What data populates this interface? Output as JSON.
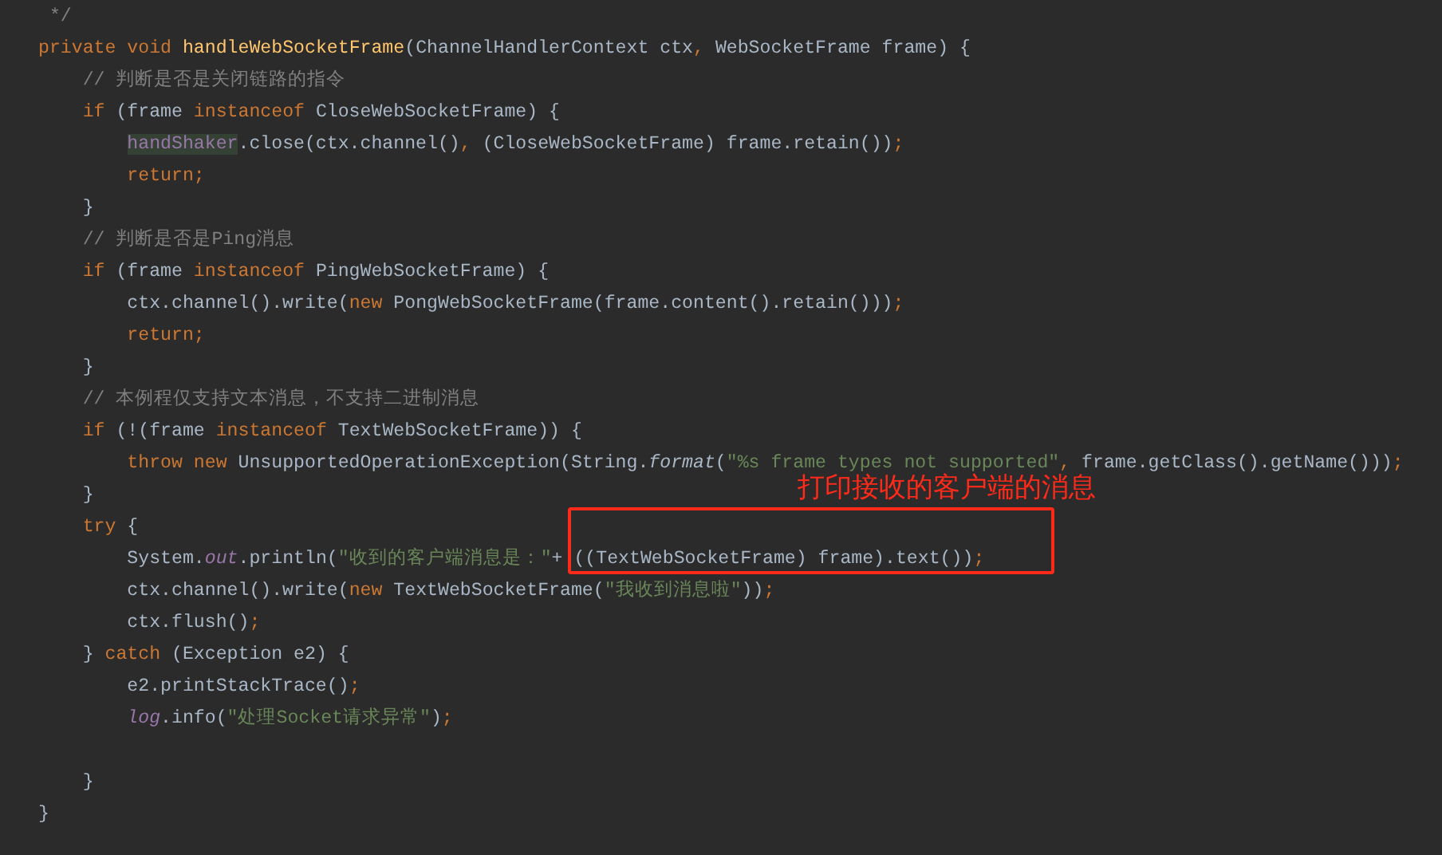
{
  "code_lines": [
    {
      "kind": "code",
      "tokens": [
        {
          "t": " */",
          "kind": "comment"
        }
      ]
    },
    {
      "kind": "code",
      "tokens": [
        {
          "t": "private void ",
          "kind": "keyword"
        },
        {
          "t": "handleWebSocketFrame",
          "kind": "decl"
        },
        {
          "t": "(ChannelHandlerContext ctx",
          "kind": "plain"
        },
        {
          "t": ", ",
          "kind": "keyword"
        },
        {
          "t": "WebSocketFrame frame) {",
          "kind": "plain"
        }
      ]
    },
    {
      "kind": "code",
      "tokens": [
        {
          "t": "    // 判断是否是关闭链路的指令",
          "kind": "comment"
        }
      ]
    },
    {
      "kind": "code",
      "tokens": [
        {
          "t": "    if ",
          "kind": "keyword"
        },
        {
          "t": "(frame ",
          "kind": "plain"
        },
        {
          "t": "instanceof ",
          "kind": "keyword"
        },
        {
          "t": "CloseWebSocketFrame) {",
          "kind": "plain"
        }
      ]
    },
    {
      "kind": "code",
      "indented": true,
      "tokens": [
        {
          "t": "handShaker",
          "kind": "highlight"
        },
        {
          "t": ".close(ctx.channel()",
          "kind": "plain"
        },
        {
          "t": ", ",
          "kind": "keyword"
        },
        {
          "t": "(CloseWebSocketFrame) frame.retain())",
          "kind": "plain"
        },
        {
          "t": ";",
          "kind": "keyword"
        }
      ]
    },
    {
      "kind": "code",
      "tokens": [
        {
          "t": "        return;",
          "kind": "keyword"
        }
      ]
    },
    {
      "kind": "code",
      "tokens": [
        {
          "t": "    }",
          "kind": "plain"
        }
      ]
    },
    {
      "kind": "code",
      "tokens": [
        {
          "t": "    // 判断是否是Ping消息",
          "kind": "comment"
        }
      ]
    },
    {
      "kind": "code",
      "tokens": [
        {
          "t": "    if ",
          "kind": "keyword"
        },
        {
          "t": "(frame ",
          "kind": "plain"
        },
        {
          "t": "instanceof ",
          "kind": "keyword"
        },
        {
          "t": "PingWebSocketFrame) {",
          "kind": "plain"
        }
      ]
    },
    {
      "kind": "code",
      "tokens": [
        {
          "t": "        ctx.channel().write(",
          "kind": "plain"
        },
        {
          "t": "new ",
          "kind": "keyword"
        },
        {
          "t": "PongWebSocketFrame(frame.content().retain()))",
          "kind": "plain"
        },
        {
          "t": ";",
          "kind": "keyword"
        }
      ]
    },
    {
      "kind": "code",
      "tokens": [
        {
          "t": "        return;",
          "kind": "keyword"
        }
      ]
    },
    {
      "kind": "code",
      "tokens": [
        {
          "t": "    }",
          "kind": "plain"
        }
      ]
    },
    {
      "kind": "code",
      "tokens": [
        {
          "t": "    // 本例程仅支持文本消息，不支持二进制消息",
          "kind": "comment"
        }
      ]
    },
    {
      "kind": "code",
      "tokens": [
        {
          "t": "    if ",
          "kind": "keyword"
        },
        {
          "t": "(!(frame ",
          "kind": "plain"
        },
        {
          "t": "instanceof ",
          "kind": "keyword"
        },
        {
          "t": "TextWebSocketFrame)) {",
          "kind": "plain"
        }
      ]
    },
    {
      "kind": "code",
      "tokens": [
        {
          "t": "        throw new ",
          "kind": "keyword"
        },
        {
          "t": "UnsupportedOperationException(String.",
          "kind": "plain"
        },
        {
          "t": "format",
          "kind": "static_method"
        },
        {
          "t": "(",
          "kind": "plain"
        },
        {
          "t": "\"%s frame types not supported\"",
          "kind": "string"
        },
        {
          "t": ", ",
          "kind": "keyword"
        },
        {
          "t": "frame.getClass().getName()))",
          "kind": "plain"
        },
        {
          "t": ";",
          "kind": "keyword"
        }
      ]
    },
    {
      "kind": "code",
      "tokens": [
        {
          "t": "    }",
          "kind": "plain"
        }
      ]
    },
    {
      "kind": "code",
      "tokens": [
        {
          "t": "    try ",
          "kind": "keyword"
        },
        {
          "t": "{",
          "kind": "plain"
        }
      ]
    },
    {
      "kind": "code",
      "tokens": [
        {
          "t": "        System.",
          "kind": "plain"
        },
        {
          "t": "out",
          "kind": "static_field"
        },
        {
          "t": ".println(",
          "kind": "plain"
        },
        {
          "t": "\"收到的客户端消息是：\"",
          "kind": "string"
        },
        {
          "t": "+ ((TextWebSocketFrame) frame).text())",
          "kind": "plain"
        },
        {
          "t": ";",
          "kind": "keyword"
        }
      ]
    },
    {
      "kind": "code",
      "tokens": [
        {
          "t": "        ctx.channel().write(",
          "kind": "plain"
        },
        {
          "t": "new ",
          "kind": "keyword"
        },
        {
          "t": "TextWebSocketFrame(",
          "kind": "plain"
        },
        {
          "t": "\"我收到消息啦\"",
          "kind": "string"
        },
        {
          "t": "))",
          "kind": "plain"
        },
        {
          "t": ";",
          "kind": "keyword"
        }
      ]
    },
    {
      "kind": "code",
      "tokens": [
        {
          "t": "        ctx.flush()",
          "kind": "plain"
        },
        {
          "t": ";",
          "kind": "keyword"
        }
      ]
    },
    {
      "kind": "code",
      "tokens": [
        {
          "t": "    } ",
          "kind": "plain"
        },
        {
          "t": "catch ",
          "kind": "keyword"
        },
        {
          "t": "(Exception e2) {",
          "kind": "plain"
        }
      ]
    },
    {
      "kind": "code",
      "tokens": [
        {
          "t": "        e2.printStackTrace()",
          "kind": "plain"
        },
        {
          "t": ";",
          "kind": "keyword"
        }
      ]
    },
    {
      "kind": "code",
      "indented": true,
      "tokens": [
        {
          "t": "log",
          "kind": "static_field"
        },
        {
          "t": ".info(",
          "kind": "plain"
        },
        {
          "t": "\"处理Socket请求异常\"",
          "kind": "string"
        },
        {
          "t": ")",
          "kind": "plain"
        },
        {
          "t": ";",
          "kind": "keyword"
        }
      ]
    },
    {
      "kind": "blank"
    },
    {
      "kind": "code",
      "tokens": [
        {
          "t": "    }",
          "kind": "plain"
        }
      ]
    },
    {
      "kind": "code",
      "tokens": [
        {
          "t": "}",
          "kind": "plain"
        }
      ]
    }
  ],
  "annotation": {
    "label": "打印接收的客户端的消息"
  }
}
